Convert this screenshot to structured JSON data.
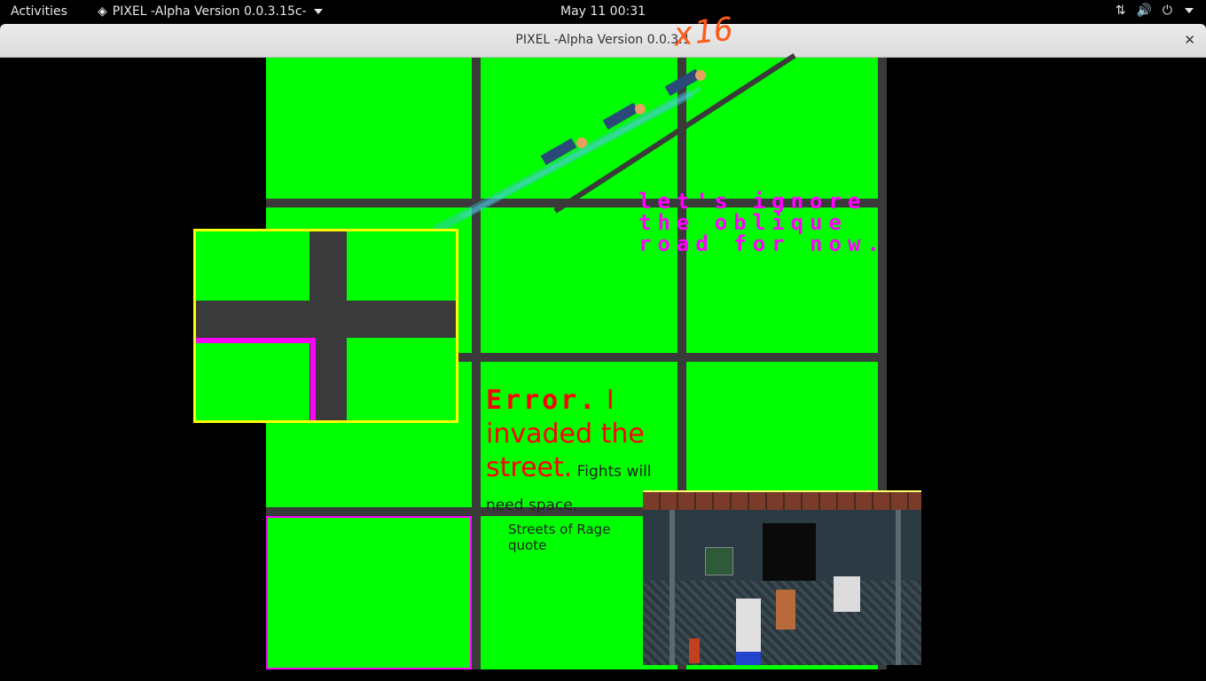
{
  "topbar": {
    "activities": "Activities",
    "app_name": "PIXEL -Alpha Version 0.0.3.15c-",
    "clock": "May 11  00:31"
  },
  "window": {
    "title": "PIXEL -Alpha Version 0.0.3.1",
    "close": "✕",
    "annotation": "x16"
  },
  "canvas": {
    "oblique_note": [
      "let's ignore",
      "the oblique",
      "road for now."
    ],
    "error_title": "Error.",
    "error_body_1": " I invaded the street.",
    "error_body_2": " Fights will need space.",
    "quote_label": "Streets of Rage quote"
  },
  "colors": {
    "grass": "#00ff00",
    "road": "#3a3a3a",
    "highlight": "#ff00ff",
    "zoom_border": "#ffff00",
    "error": "#ff0000",
    "annotation": "#ff5a1a"
  }
}
